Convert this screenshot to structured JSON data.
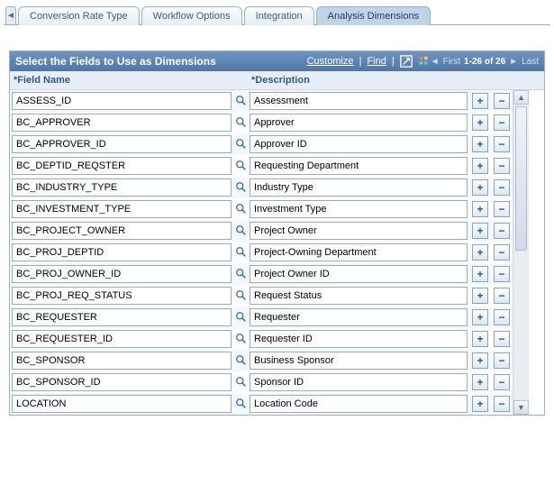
{
  "tabs": {
    "items": [
      {
        "label": "Conversion Rate Type"
      },
      {
        "label": "Workflow Options"
      },
      {
        "label": "Integration"
      },
      {
        "label": "Analysis Dimensions"
      }
    ],
    "active_index": 3
  },
  "grid": {
    "title": "Select the Fields to Use as Dimensions",
    "links": {
      "customize": "Customize",
      "find": "Find"
    },
    "nav": {
      "first": "First",
      "last": "Last",
      "range": "1-26 of 26"
    },
    "columns": {
      "field_name": "*Field Name",
      "description": "*Description"
    },
    "rows": [
      {
        "field": "ASSESS_ID",
        "desc": "Assessment"
      },
      {
        "field": "BC_APPROVER",
        "desc": "Approver"
      },
      {
        "field": "BC_APPROVER_ID",
        "desc": "Approver ID"
      },
      {
        "field": "BC_DEPTID_REQSTER",
        "desc": "Requesting Department"
      },
      {
        "field": "BC_INDUSTRY_TYPE",
        "desc": "Industry Type"
      },
      {
        "field": "BC_INVESTMENT_TYPE",
        "desc": "Investment Type"
      },
      {
        "field": "BC_PROJECT_OWNER",
        "desc": "Project Owner"
      },
      {
        "field": "BC_PROJ_DEPTID",
        "desc": "Project-Owning Department"
      },
      {
        "field": "BC_PROJ_OWNER_ID",
        "desc": "Project Owner ID"
      },
      {
        "field": "BC_PROJ_REQ_STATUS",
        "desc": "Request Status"
      },
      {
        "field": "BC_REQUESTER",
        "desc": "Requester"
      },
      {
        "field": "BC_REQUESTER_ID",
        "desc": "Requester ID"
      },
      {
        "field": "BC_SPONSOR",
        "desc": "Business Sponsor"
      },
      {
        "field": "BC_SPONSOR_ID",
        "desc": "Sponsor ID"
      },
      {
        "field": "LOCATION",
        "desc": "Location Code"
      }
    ]
  }
}
